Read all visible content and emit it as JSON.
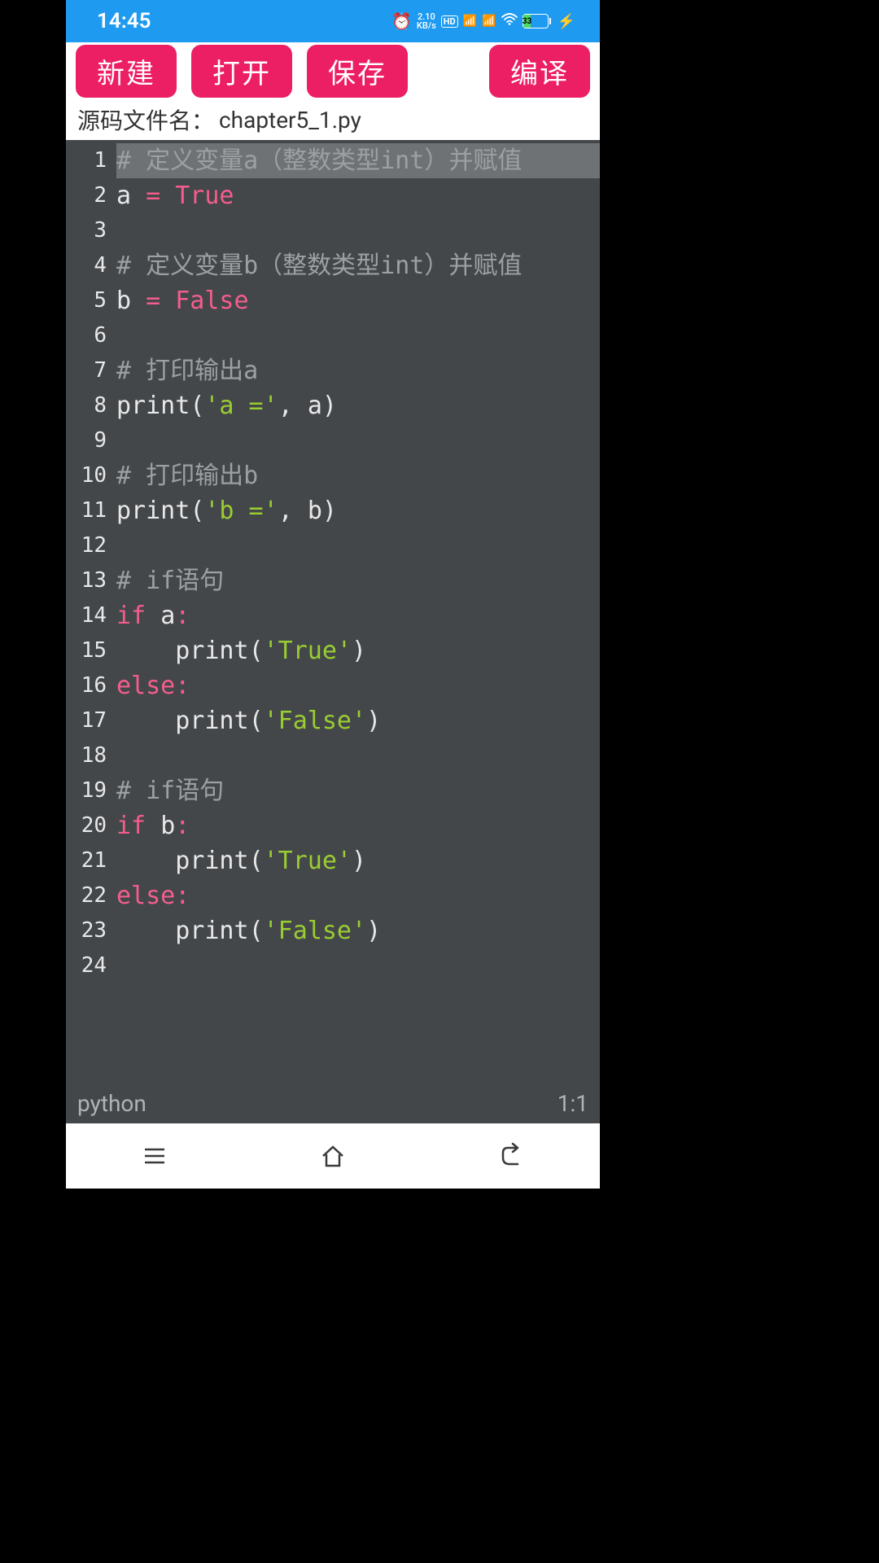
{
  "status": {
    "time": "14:45",
    "kbps_top": "2.10",
    "kbps_bot": "KB/s",
    "hd": "HD",
    "sig1": "4G",
    "sig2": "5G",
    "battery_pct": "33"
  },
  "toolbar": {
    "new": "新建",
    "open": "打开",
    "save": "保存",
    "compile": "编译"
  },
  "filebar": {
    "label": "源码文件名：",
    "name": "chapter5_1.py"
  },
  "code": {
    "lines": [
      {
        "n": "1",
        "type": "comment",
        "text": "# 定义变量a（整数类型int）并赋值",
        "hl": true
      },
      {
        "n": "2",
        "type": "assign",
        "id": "a",
        "val": "True"
      },
      {
        "n": "3",
        "type": "blank"
      },
      {
        "n": "4",
        "type": "comment",
        "text": "# 定义变量b（整数类型int）并赋值"
      },
      {
        "n": "5",
        "type": "assign",
        "id": "b",
        "val": "False"
      },
      {
        "n": "6",
        "type": "blank"
      },
      {
        "n": "7",
        "type": "comment",
        "text": "# 打印输出a"
      },
      {
        "n": "8",
        "type": "print",
        "str": "'a ='",
        "arg": "a"
      },
      {
        "n": "9",
        "type": "blank"
      },
      {
        "n": "10",
        "type": "comment",
        "text": "# 打印输出b"
      },
      {
        "n": "11",
        "type": "print",
        "str": "'b ='",
        "arg": "b"
      },
      {
        "n": "12",
        "type": "blank"
      },
      {
        "n": "13",
        "type": "comment",
        "text": "# if语句"
      },
      {
        "n": "14",
        "type": "if",
        "cond": "a"
      },
      {
        "n": "15",
        "type": "printind",
        "str": "'True'"
      },
      {
        "n": "16",
        "type": "else"
      },
      {
        "n": "17",
        "type": "printind",
        "str": "'False'"
      },
      {
        "n": "18",
        "type": "blank"
      },
      {
        "n": "19",
        "type": "comment",
        "text": "# if语句"
      },
      {
        "n": "20",
        "type": "if",
        "cond": "b"
      },
      {
        "n": "21",
        "type": "printind",
        "str": "'True'"
      },
      {
        "n": "22",
        "type": "else"
      },
      {
        "n": "23",
        "type": "printind",
        "str": "'False'"
      },
      {
        "n": "24",
        "type": "blank"
      }
    ]
  },
  "footer": {
    "lang": "python",
    "pos": "1:1"
  }
}
